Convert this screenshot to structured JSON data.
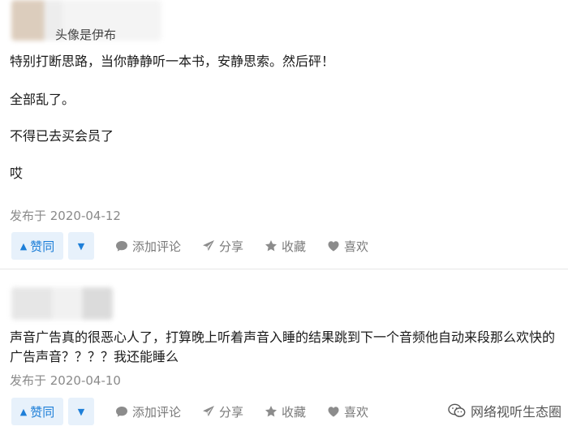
{
  "posts": [
    {
      "username": "头像是伊布",
      "paragraphs": [
        "特别打断思路，当你静静听一本书，安静思索。然后砰！",
        "全部乱了。",
        "不得已去买会员了",
        "哎"
      ],
      "date": "发布于 2020-04-12",
      "actions": {
        "vote_up": "赞同",
        "comment": "添加评论",
        "share": "分享",
        "favorite": "收藏",
        "like": "喜欢"
      }
    },
    {
      "paragraphs": [
        "声音广告真的很恶心人了，打算晚上听着声音入睡的结果跳到下一个音频他自动来段那么欢快的广告声音？？？？我还能睡么"
      ],
      "date": "发布于 2020-04-10",
      "actions": {
        "vote_up": "赞同",
        "comment": "添加评论",
        "share": "分享",
        "favorite": "收藏",
        "like": "喜欢"
      }
    }
  ],
  "watermark": "网络视听生态圈",
  "colors": {
    "accent": "#1e7fd8",
    "vote_bg": "#e7f1fb",
    "muted": "#8a8a8a",
    "action_gray": "#7a7a7a"
  },
  "icons": {
    "vote_up": "triangle-up-icon",
    "vote_down": "triangle-down-icon",
    "comment": "speech-bubble-icon",
    "share": "paper-plane-icon",
    "favorite": "star-icon",
    "like": "heart-icon",
    "watermark": "wechat-logo-icon"
  }
}
